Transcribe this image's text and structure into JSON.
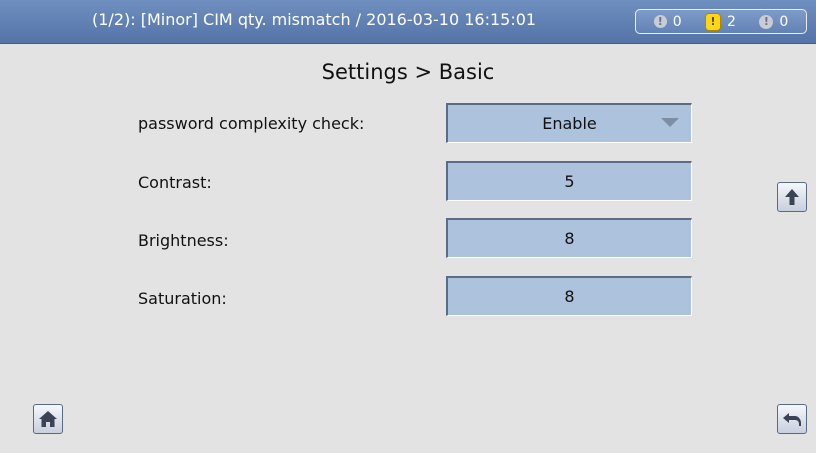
{
  "header": {
    "alarm_text": "(1/2): [Minor] CIM qty. mismatch / 2016-03-10 16:15:01",
    "counters": [
      {
        "icon": "critical-alarm-icon",
        "value": "0"
      },
      {
        "icon": "major-alarm-icon",
        "value": "2"
      },
      {
        "icon": "minor-alarm-icon",
        "value": "0"
      }
    ]
  },
  "page": {
    "title": "Settings > Basic"
  },
  "settings": [
    {
      "label": "password complexity check:",
      "value": "Enable",
      "type": "dropdown"
    },
    {
      "label": "Contrast:",
      "value": "5",
      "type": "field"
    },
    {
      "label": "Brightness:",
      "value": "8",
      "type": "field"
    },
    {
      "label": "Saturation:",
      "value": "8",
      "type": "field"
    }
  ],
  "nav": {
    "scroll_up": "arrow-up-icon",
    "home": "home-icon",
    "back": "back-icon"
  },
  "colors": {
    "header": "#5f7fb4",
    "field": "#adc2dc",
    "background": "#e3e3e3",
    "major_alarm": "#ffd51a"
  }
}
